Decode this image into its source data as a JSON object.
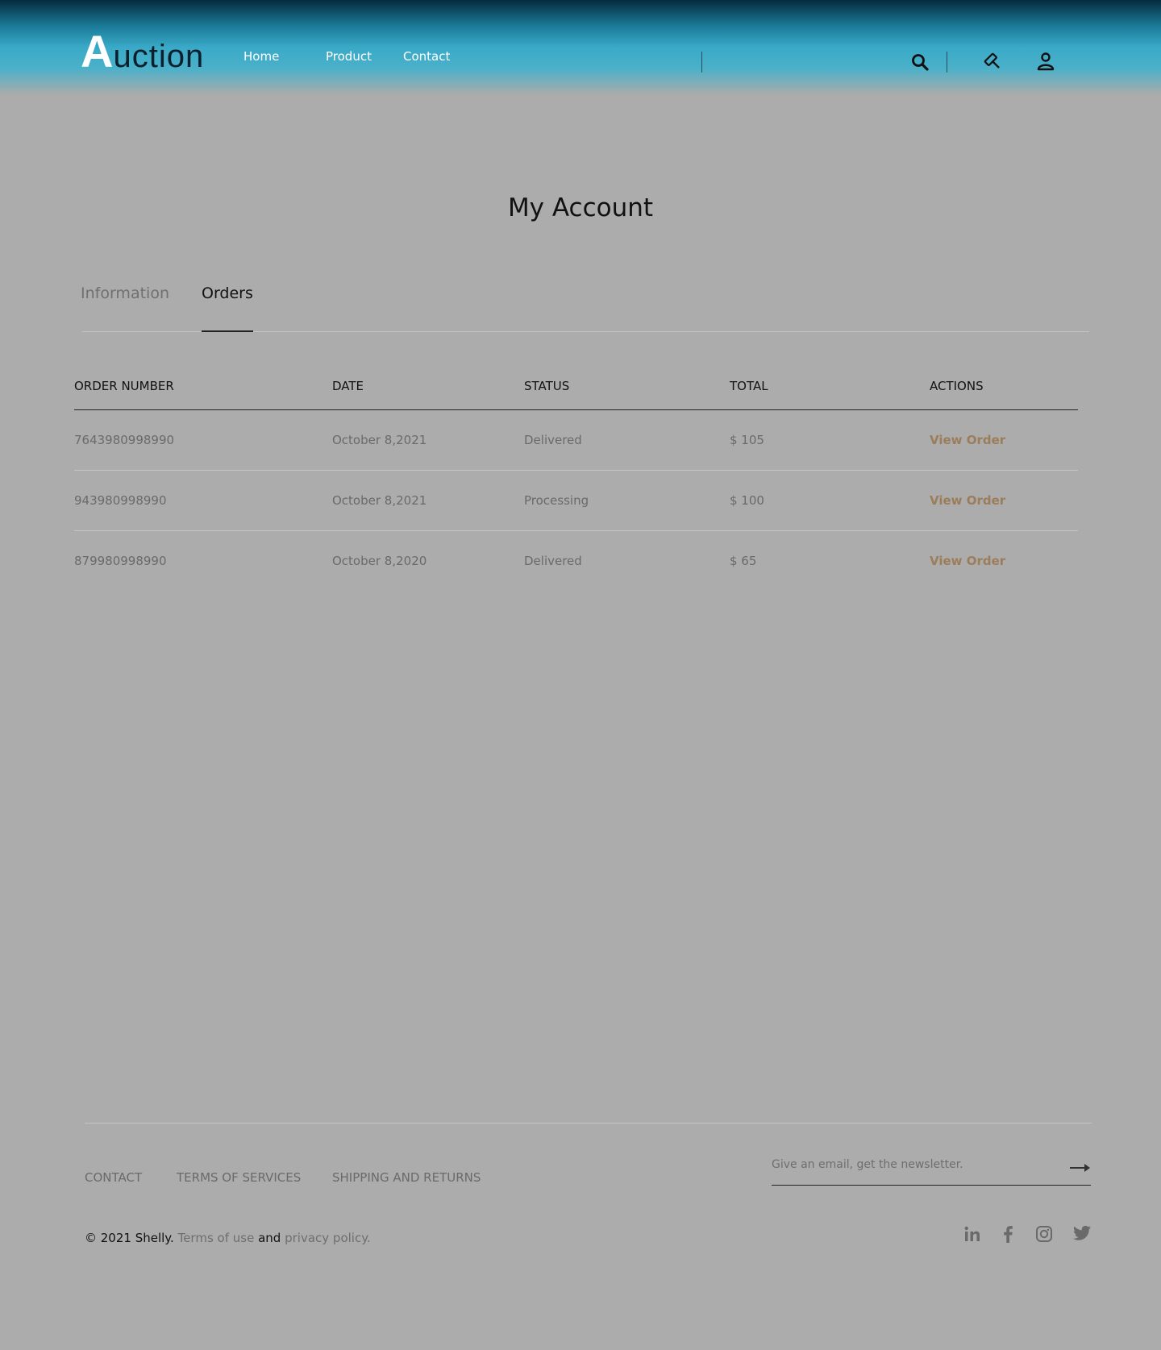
{
  "header": {
    "logo_big": "A",
    "logo_rest": "uction",
    "nav": [
      {
        "label": "Home"
      },
      {
        "label": "Product"
      },
      {
        "label": "Contact"
      }
    ],
    "icons": [
      "search-icon",
      "gavel-icon",
      "user-icon"
    ]
  },
  "page": {
    "title": "My Account"
  },
  "tabs": [
    {
      "label": "Information",
      "active": false
    },
    {
      "label": "Orders",
      "active": true
    }
  ],
  "orders": {
    "headers": [
      "ORDER NUMBER",
      "DATE",
      "STATUS",
      "TOTAL",
      "ACTIONS"
    ],
    "rows": [
      {
        "number": "7643980998990",
        "date": "October 8,2021",
        "status": "Delivered",
        "total": "$ 105",
        "action": "View Order"
      },
      {
        "number": "943980998990",
        "date": "October 8,2021",
        "status": "Processing",
        "total": "$ 100",
        "action": "View Order"
      },
      {
        "number": "879980998990",
        "date": "October 8,2020",
        "status": "Delivered",
        "total": "$ 65",
        "action": "View Order"
      }
    ]
  },
  "footer": {
    "links": [
      {
        "label": "CONTACT"
      },
      {
        "label": "TERMS OF SERVICES"
      },
      {
        "label": "SHIPPING AND RETURNS"
      }
    ],
    "newsletter_placeholder": "Give an email, get the newsletter.",
    "copyright_main": "© 2021 Shelly.",
    "terms_link": "Terms of use",
    "and_text": "and",
    "privacy_link": "privacy policy.",
    "social": [
      "linkedin-icon",
      "facebook-icon",
      "instagram-icon",
      "twitter-icon"
    ]
  },
  "colors": {
    "background": "#acacac",
    "header_accent": "#3aaac8",
    "action_link": "#9c7d5a"
  }
}
